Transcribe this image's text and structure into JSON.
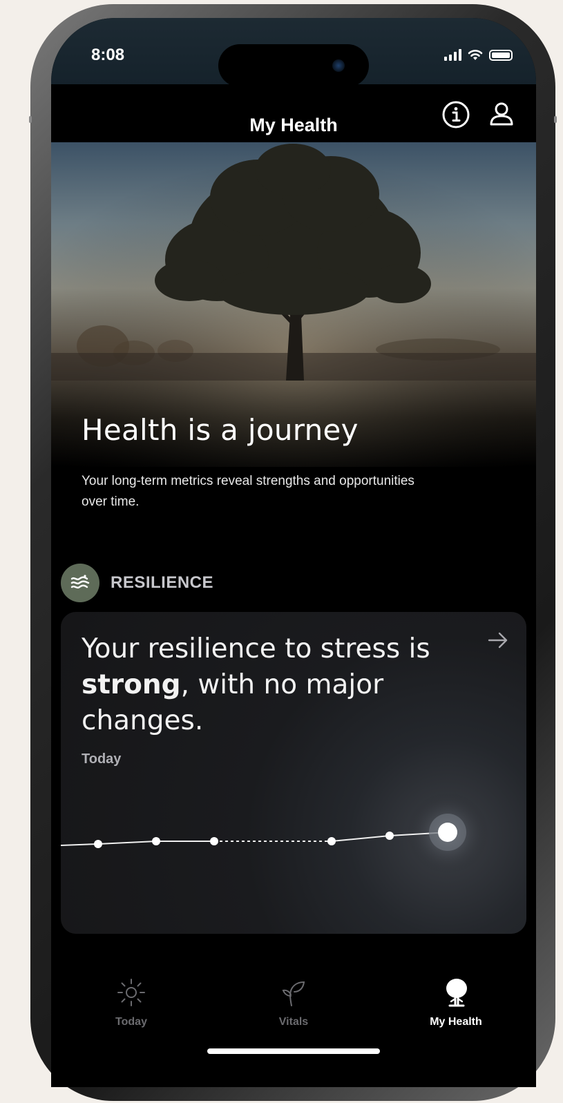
{
  "status": {
    "time": "8:08"
  },
  "header": {
    "title": "My Health"
  },
  "hero": {
    "title": "Health is a journey",
    "subtitle": "Your long-term metrics reveal strengths and opportunities over time."
  },
  "section": {
    "label": "RESILIENCE"
  },
  "card": {
    "headline_pre": "Your resilience to stress is ",
    "headline_bold": "strong",
    "headline_post": ", with no major changes.",
    "date_label": "Today"
  },
  "tabs": [
    {
      "label": "Today",
      "icon": "sun-icon",
      "active": false
    },
    {
      "label": "Vitals",
      "icon": "sprout-icon",
      "active": false
    },
    {
      "label": "My Health",
      "icon": "tree-icon",
      "active": true
    }
  ],
  "colors": {
    "accent_section": "#5e6b58",
    "background": "#000000"
  }
}
